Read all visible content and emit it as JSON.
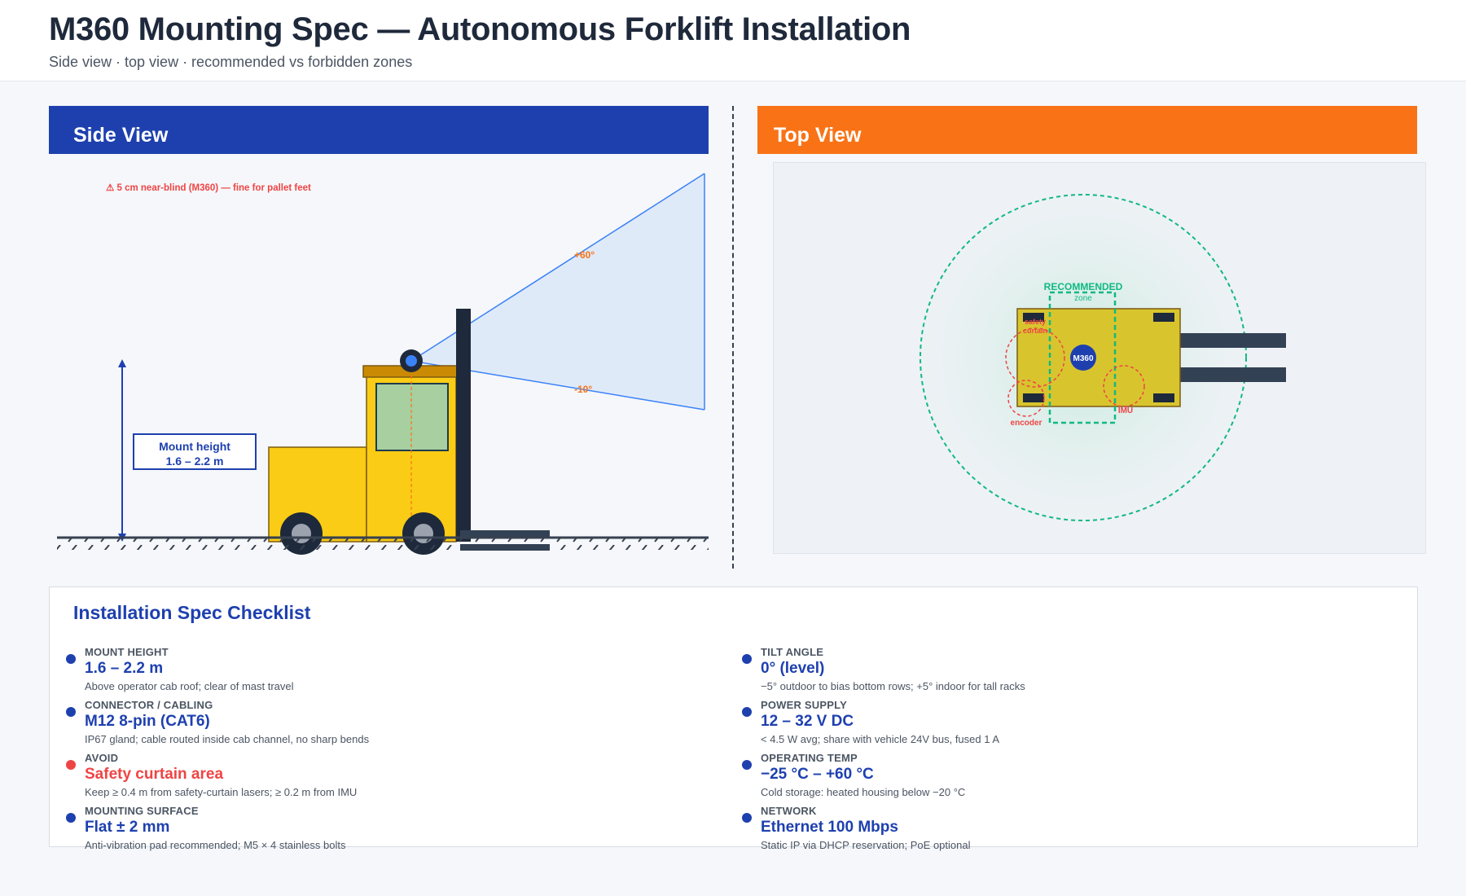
{
  "header": {
    "title": "M360 Mounting Spec — Autonomous Forklift Installation",
    "subtitle": "Side view · top view · recommended vs forbidden zones"
  },
  "side_view": {
    "heading": "Side View",
    "warning": "⚠ 5 cm near-blind (M360) — fine for pallet feet",
    "angle_up": "+60°",
    "angle_down": "-10°",
    "mount_height_line1": "Mount height",
    "mount_height_line2": "1.6 – 2.2 m"
  },
  "top_view": {
    "heading": "Top View",
    "recommended_label": "RECOMMENDED",
    "zone_label": "zone",
    "sensor_label": "M360",
    "safety_curtain_label_1": "safety",
    "safety_curtain_label_2": "curtain",
    "encoder_label": "encoder",
    "imu_label": "IMU"
  },
  "colors": {
    "side_header": "#1e40af",
    "top_header": "#f97316",
    "accent_blue": "#1e40af",
    "forbidden_red": "#ef4444",
    "recommended_green": "#10b981",
    "forklift_yellow": "#facc15",
    "fov_fill": "#dbe7f8"
  },
  "checklist": {
    "title": "Installation Spec Checklist",
    "items": [
      {
        "label": "MOUNT HEIGHT",
        "value": "1.6 – 2.2 m",
        "note": "Above operator cab roof; clear of mast travel",
        "status": "ok"
      },
      {
        "label": "CONNECTOR / CABLING",
        "value": "M12 8-pin (CAT6)",
        "note": "IP67 gland; cable routed inside cab channel, no sharp bends",
        "status": "ok"
      },
      {
        "label": "AVOID",
        "value": "Safety curtain area",
        "note": "Keep ≥ 0.4 m from safety-curtain lasers; ≥ 0.2 m from IMU",
        "status": "avoid"
      },
      {
        "label": "MOUNTING SURFACE",
        "value": "Flat ± 2 mm",
        "note": "Anti-vibration pad recommended; M5 × 4 stainless bolts",
        "status": "ok"
      },
      {
        "label": "TILT ANGLE",
        "value": "0° (level)",
        "note": "−5° outdoor to bias bottom rows; +5° indoor for tall racks",
        "status": "ok"
      },
      {
        "label": "POWER SUPPLY",
        "value": "12 – 32 V DC",
        "note": "< 4.5 W avg; share with vehicle 24V bus, fused 1 A",
        "status": "ok"
      },
      {
        "label": "OPERATING TEMP",
        "value": "−25 °C – +60 °C",
        "note": "Cold storage: heated housing below −20 °C",
        "status": "ok"
      },
      {
        "label": "NETWORK",
        "value": "Ethernet 100 Mbps",
        "note": "Static IP via DHCP reservation; PoE optional",
        "status": "ok"
      }
    ]
  }
}
